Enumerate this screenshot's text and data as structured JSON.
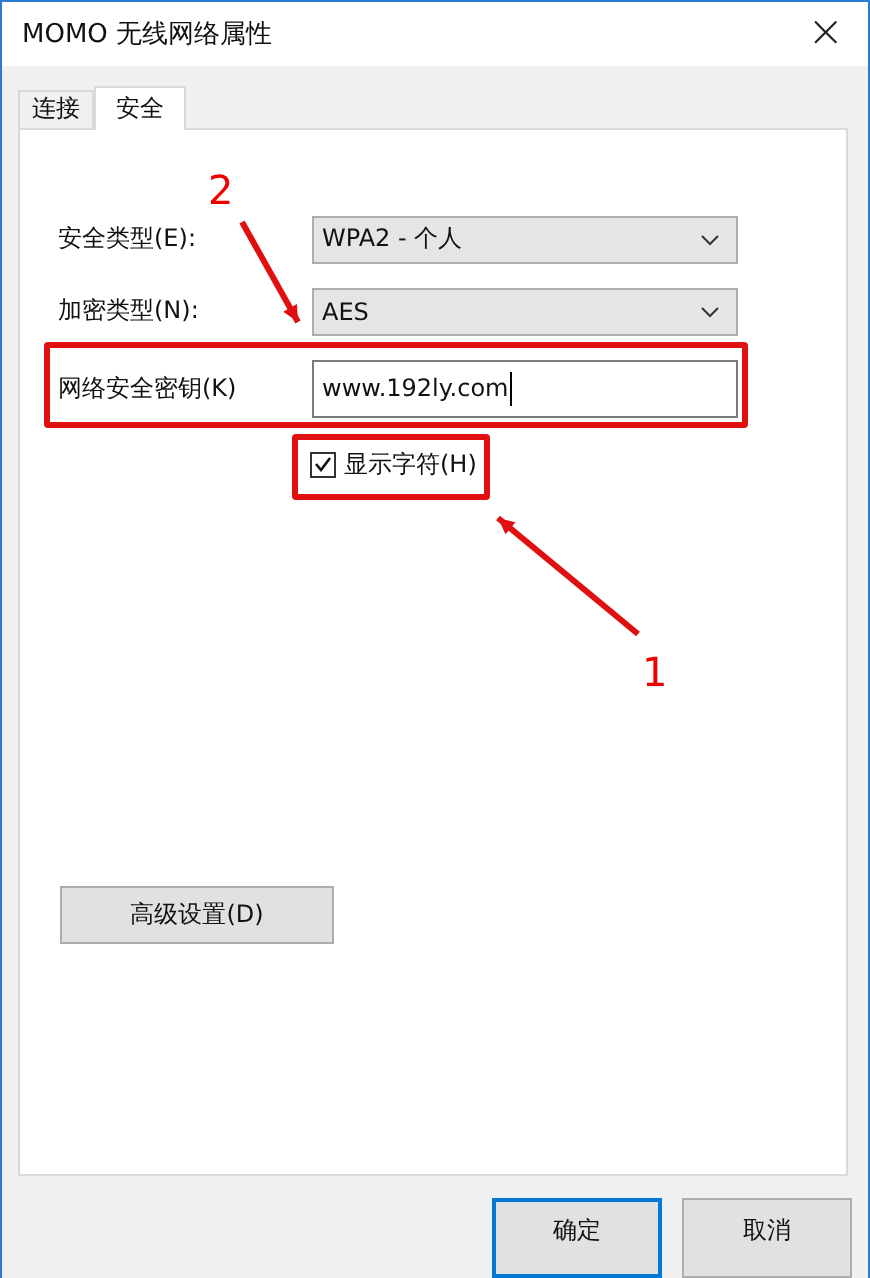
{
  "window": {
    "title": "MOMO 无线网络属性",
    "close": "×"
  },
  "tabs": [
    {
      "label": "连接",
      "selected": false
    },
    {
      "label": "安全",
      "selected": true
    }
  ],
  "form": {
    "security_type": {
      "label": "安全类型(E):",
      "value": "WPA2 - 个人"
    },
    "encryption_type": {
      "label": "加密类型(N):",
      "value": "AES"
    },
    "key": {
      "label": "网络安全密钥(K)",
      "value": "www.192ly.com"
    },
    "show_chars": {
      "label": "显示字符(H)",
      "checked": true
    }
  },
  "advanced_button": "高级设置(D)",
  "buttons": [
    {
      "label": "确定",
      "default": true
    },
    {
      "label": "取消",
      "default": false
    }
  ],
  "annotations": [
    {
      "kind": "arrow",
      "label": "2"
    },
    {
      "kind": "arrow",
      "label": "1"
    },
    {
      "kind": "box"
    },
    {
      "kind": "box"
    }
  ]
}
